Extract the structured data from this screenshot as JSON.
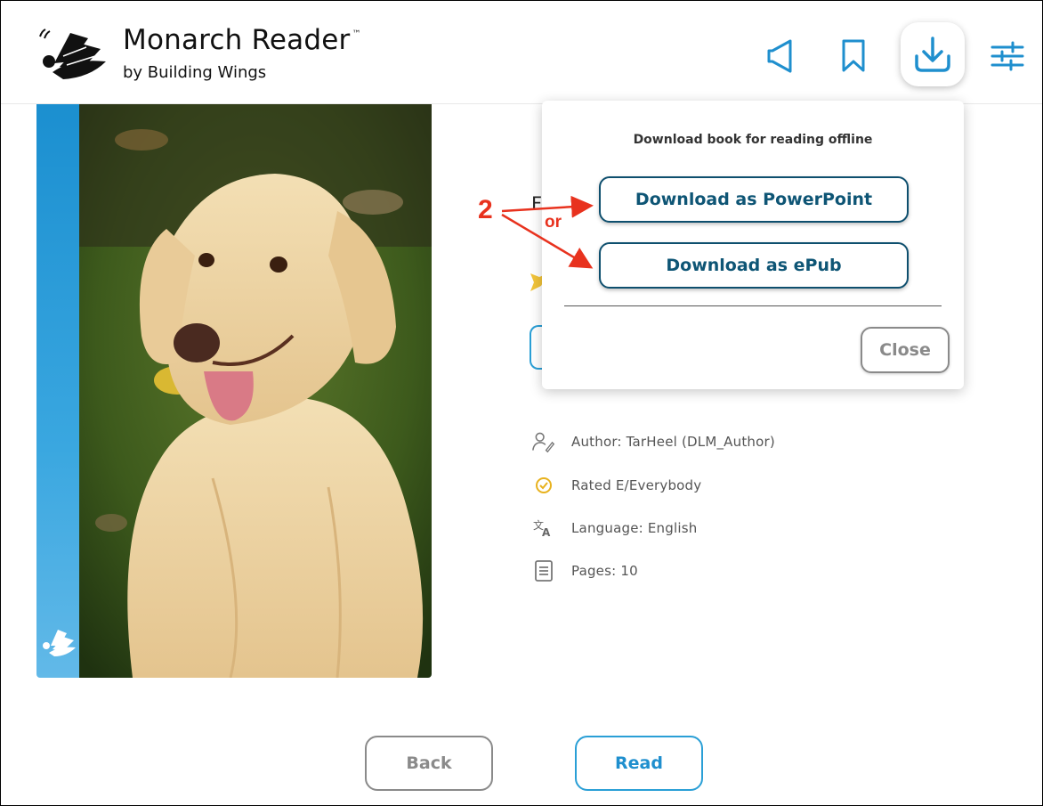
{
  "header": {
    "brand_title": "Monarch Reader",
    "brand_tm": "™",
    "brand_subtitle": "by Building Wings",
    "icons": [
      "speaker-icon",
      "bookmark-icon",
      "download-icon",
      "settings-sliders-icon"
    ]
  },
  "download_popover": {
    "heading": "Download book for reading offline",
    "powerpoint_label": "Download as PowerPoint",
    "epub_label": "Download as ePub",
    "close_label": "Close"
  },
  "annotation": {
    "step_number": "2",
    "or_label": "or"
  },
  "book_partial_title": "F",
  "book_info": {
    "author": "Author: TarHeel (DLM_Author)",
    "rating": "Rated E/Everybody",
    "language": "Language: English",
    "pages": "Pages: 10"
  },
  "footer": {
    "back_label": "Back",
    "read_label": "Read"
  },
  "colors": {
    "accent_blue": "#2a9fd6",
    "popover_button_border": "#0e4f6e",
    "annotation_red": "#e8321e",
    "disabled_gray": "#8a8a8a"
  }
}
